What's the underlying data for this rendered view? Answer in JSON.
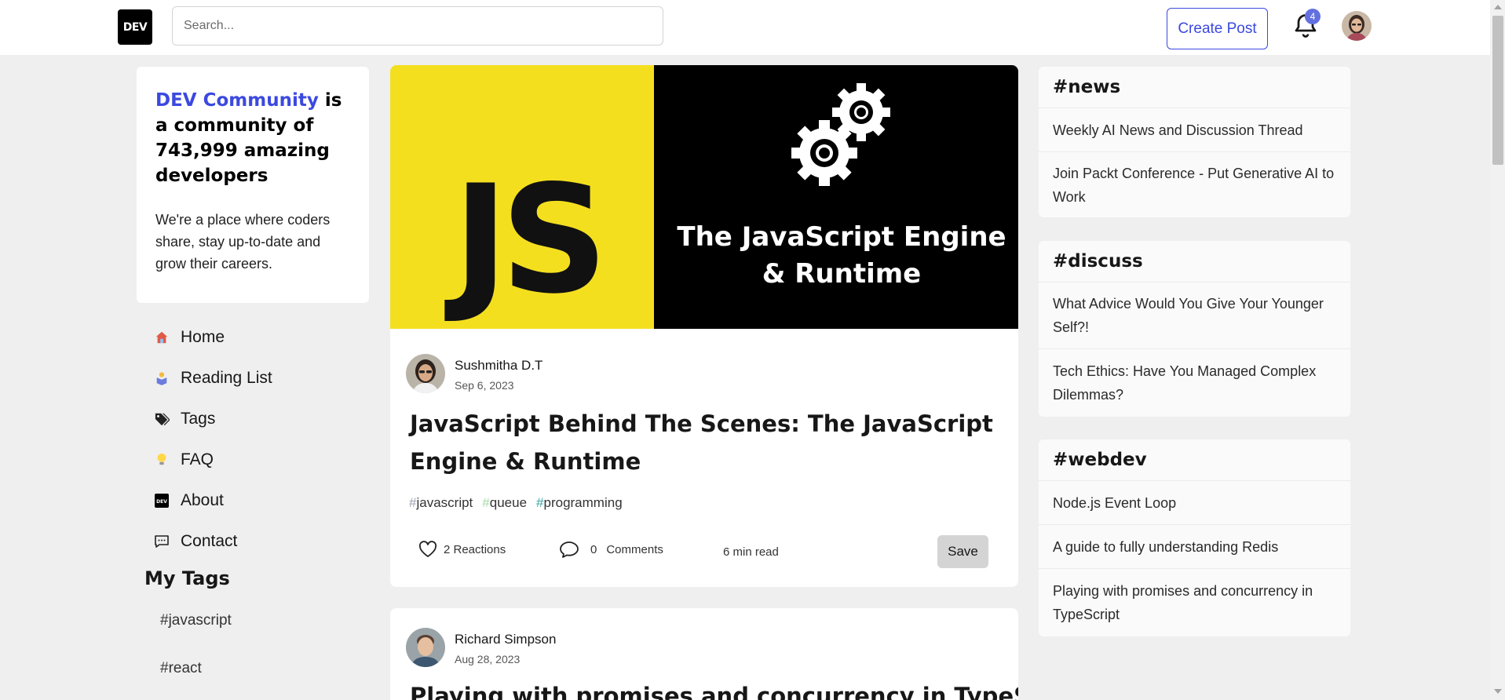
{
  "header": {
    "logo_text": "DEV",
    "search_placeholder": "Search...",
    "create_post_label": "Create Post",
    "notification_count": "4"
  },
  "sidebar": {
    "community": {
      "brand": "DEV Community",
      "title_rest": " is a community of 743,999 amazing developers",
      "description": "We're a place where coders share, stay up-to-date and grow their careers."
    },
    "nav": [
      {
        "label": "Home",
        "icon": "house-icon"
      },
      {
        "label": "Reading List",
        "icon": "reading-list-icon"
      },
      {
        "label": "Tags",
        "icon": "tag-icon"
      },
      {
        "label": "FAQ",
        "icon": "lightbulb-icon"
      },
      {
        "label": "About",
        "icon": "dev-logo-icon"
      },
      {
        "label": "Contact",
        "icon": "chat-icon"
      }
    ],
    "my_tags_title": "My Tags",
    "my_tags": [
      "#javascript",
      "#react"
    ]
  },
  "feed": {
    "articles": [
      {
        "cover_js_text": "JS",
        "cover_text": "The JavaScript Engine & Runtime",
        "author": "Sushmitha D.T",
        "date": "Sep 6, 2023",
        "title": "JavaScript Behind The Scenes: The JavaScript Engine & Runtime",
        "tags": [
          "javascript",
          "queue",
          "programming"
        ],
        "reactions": "2 Reactions",
        "comment_count": "0",
        "comments_label": "Comments",
        "read_time": "6 min read",
        "save_label": "Save"
      },
      {
        "author": "Richard Simpson",
        "date": "Aug 28, 2023",
        "title": "Playing with promises and concurrency in TypeScript"
      }
    ]
  },
  "right_sidebar": {
    "cards": [
      {
        "title": "#news",
        "items": [
          "Weekly AI News and Discussion Thread",
          "Join Packt Conference - Put Generative AI to Work"
        ]
      },
      {
        "title": "#discuss",
        "items": [
          "What Advice Would You Give Your Younger Self?!",
          "Tech Ethics: Have You Managed Complex Dilemmas?"
        ]
      },
      {
        "title": "#webdev",
        "items": [
          "Node.js Event Loop",
          "A guide to fully understanding Redis",
          "Playing with promises and concurrency in TypeScript"
        ]
      }
    ]
  },
  "colors": {
    "brand_blue": "#3b49df",
    "badge": "#6270e0",
    "js_yellow": "#f4df1f",
    "page_bg": "#efefef"
  }
}
